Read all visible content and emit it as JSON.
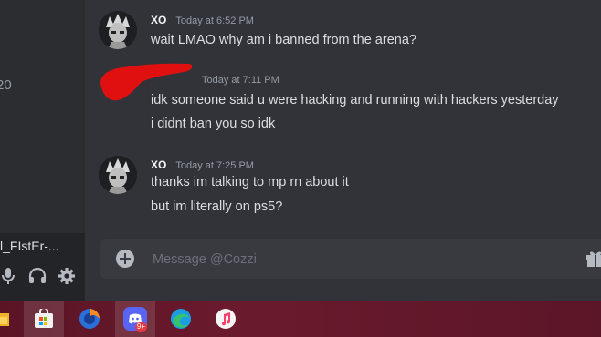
{
  "sidebar": {
    "partial_text": "20",
    "user_panel": {
      "username": "l_FIstEr-..."
    }
  },
  "messages": [
    {
      "author": "XO",
      "timestamp": "Today at 6:52 PM",
      "lines": [
        "wait LMAO why am i banned from the arena?"
      ]
    },
    {
      "author": "",
      "timestamp": "Today at 7:11 PM",
      "lines": [
        "idk someone said u were hacking and running with hackers yesterday",
        "i didnt ban you so idk"
      ]
    },
    {
      "author": "XO",
      "timestamp": "Today at 7:25 PM",
      "lines": [
        "thanks im talking to mp rn about it",
        "but im literally on ps5?"
      ]
    }
  ],
  "composer": {
    "placeholder": "Message @Cozzi"
  },
  "taskbar": {
    "discord_badge": "9+"
  },
  "colors": {
    "background": "#313338",
    "sidebar": "#2b2d31",
    "redaction": "#e01010",
    "taskbar": "#5a1525"
  }
}
